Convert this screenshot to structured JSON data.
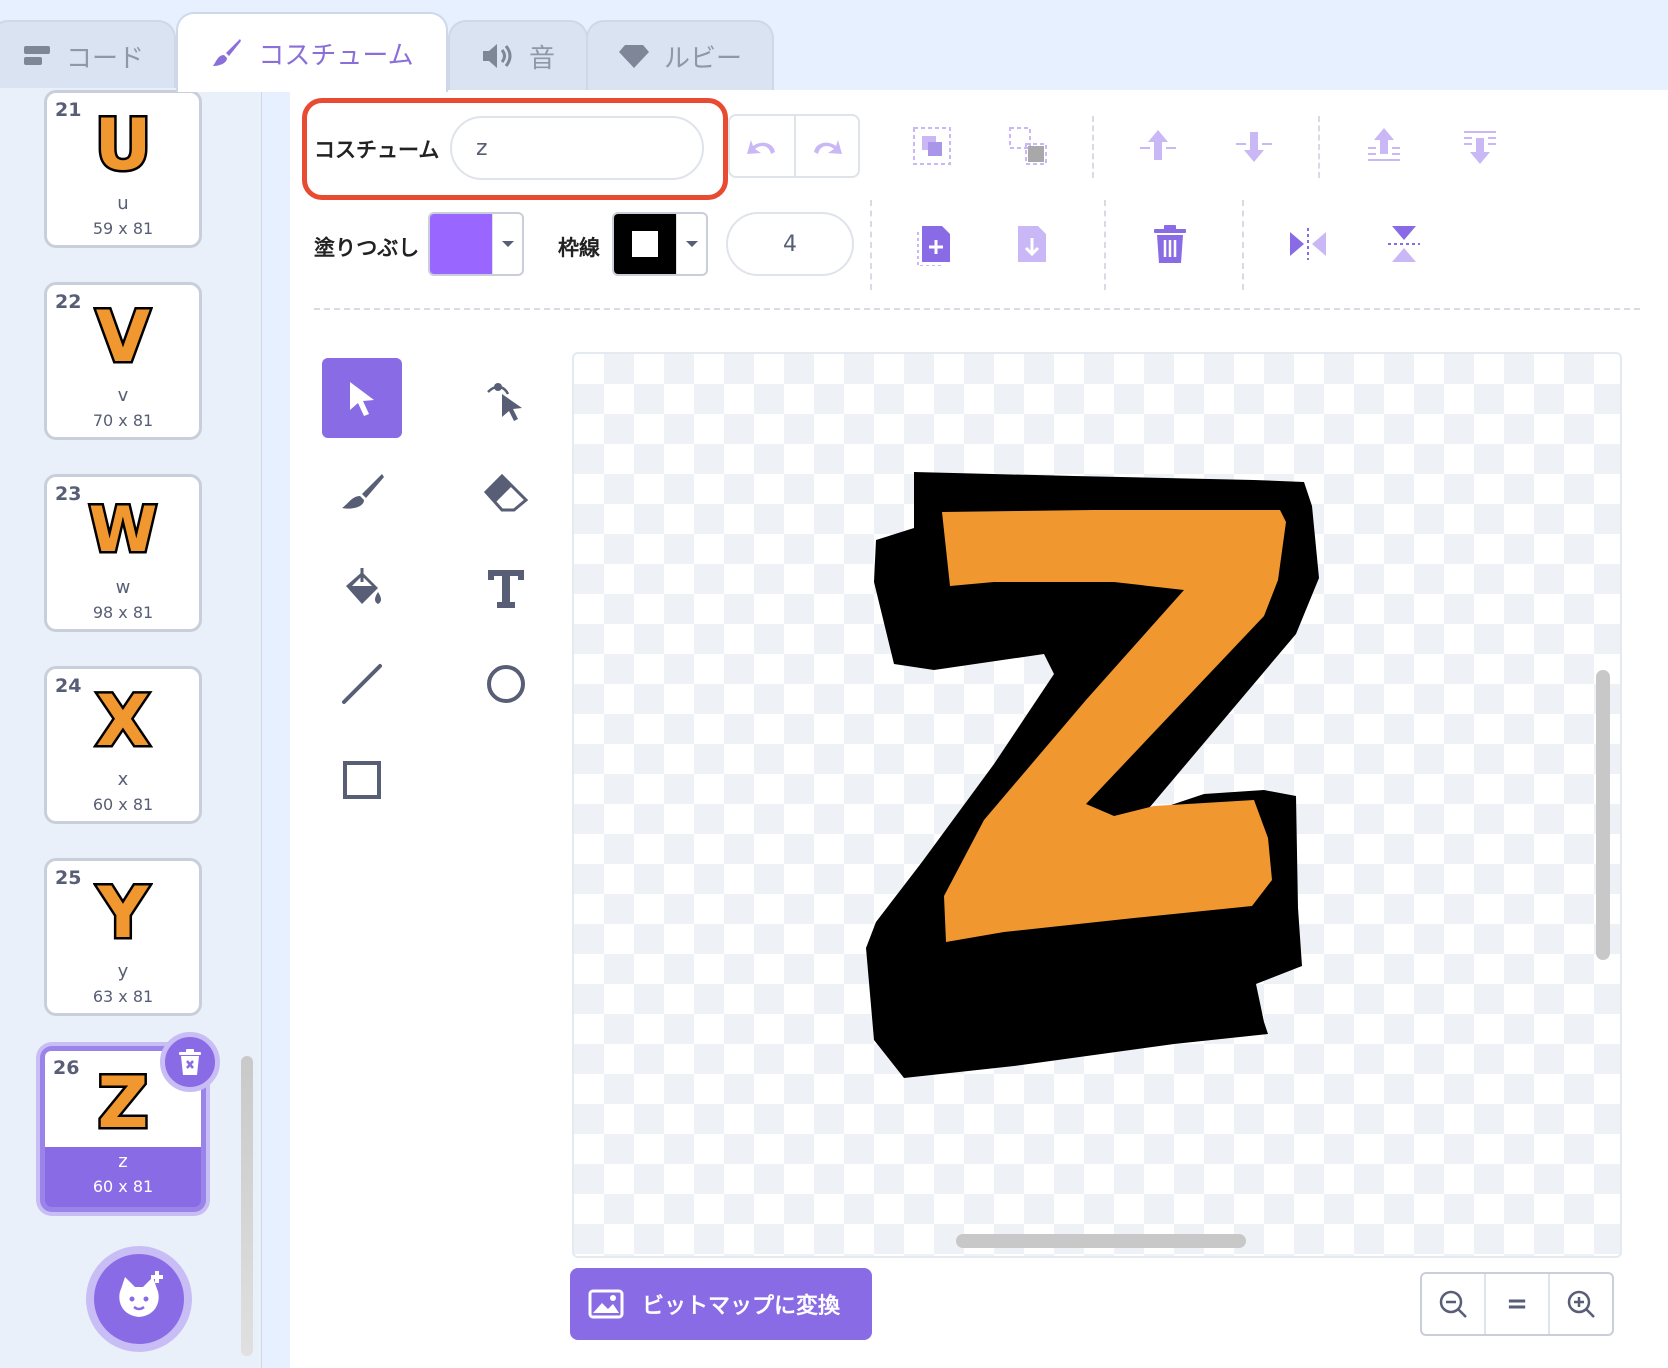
{
  "tabs": [
    {
      "label": "コード",
      "icon": "code-blocks-icon"
    },
    {
      "label": "コスチューム",
      "icon": "brush-icon"
    },
    {
      "label": "音",
      "icon": "speaker-icon"
    },
    {
      "label": "ルビー",
      "icon": "gem-icon"
    }
  ],
  "active_tab": "コスチューム",
  "costumes": [
    {
      "index": "21",
      "name": "u",
      "size": "59 x 81",
      "glyph": "U"
    },
    {
      "index": "22",
      "name": "v",
      "size": "70 x 81",
      "glyph": "V"
    },
    {
      "index": "23",
      "name": "w",
      "size": "98 x 81",
      "glyph": "W"
    },
    {
      "index": "24",
      "name": "x",
      "size": "60 x 81",
      "glyph": "X"
    },
    {
      "index": "25",
      "name": "y",
      "size": "63 x 81",
      "glyph": "Y"
    },
    {
      "index": "26",
      "name": "z",
      "size": "60 x 81",
      "glyph": "Z"
    }
  ],
  "selected_costume": "z",
  "editor": {
    "costume_label": "コスチューム",
    "costume_name_value": "z",
    "fill_label": "塗りつぶし",
    "outline_label": "枠線",
    "outline_width": "4",
    "fill_color": "#9966ff",
    "outline_color": "#000000",
    "convert_bitmap_label": "ビットマップに変換",
    "zoom_reset_label": "="
  },
  "colors": {
    "accent": "#8a6be6",
    "highlight_box": "#e84a32",
    "letter_fill": "#f0982f",
    "letter_outline": "#000000"
  }
}
